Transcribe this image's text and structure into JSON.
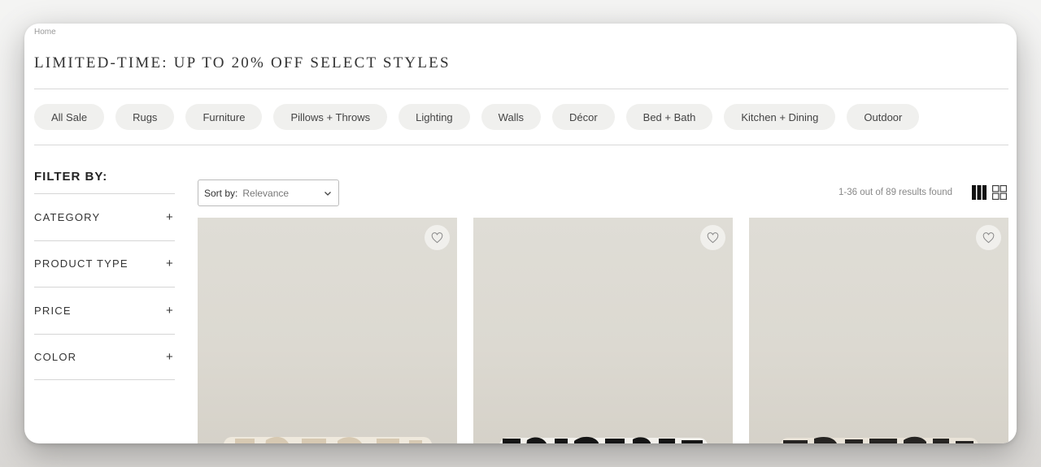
{
  "breadcrumb": "Home",
  "title": "LIMITED-TIME: UP TO 20% OFF SELECT STYLES",
  "categories": [
    "All Sale",
    "Rugs",
    "Furniture",
    "Pillows + Throws",
    "Lighting",
    "Walls",
    "Décor",
    "Bed + Bath",
    "Kitchen + Dining",
    "Outdoor"
  ],
  "filter": {
    "title": "FILTER BY:",
    "items": [
      "CATEGORY",
      "PRODUCT TYPE",
      "PRICE",
      "COLOR"
    ],
    "expand_icon": "plus-icon"
  },
  "sort": {
    "label": "Sort by:",
    "value": "Relevance"
  },
  "results_text": "1-36 out of 89 results found",
  "view_icons": [
    "three-column-view-icon",
    "grid-view-icon"
  ],
  "products": [
    {
      "image": "cream bolster pillow on light background",
      "icon": "heart-icon",
      "pattern_color": "#e6dccb"
    },
    {
      "image": "black and white bolster pillow",
      "icon": "heart-icon",
      "pattern_color": "#1b1b1b"
    },
    {
      "image": "black and cream bolster pillow",
      "icon": "heart-icon",
      "pattern_color": "#2a2826"
    }
  ]
}
